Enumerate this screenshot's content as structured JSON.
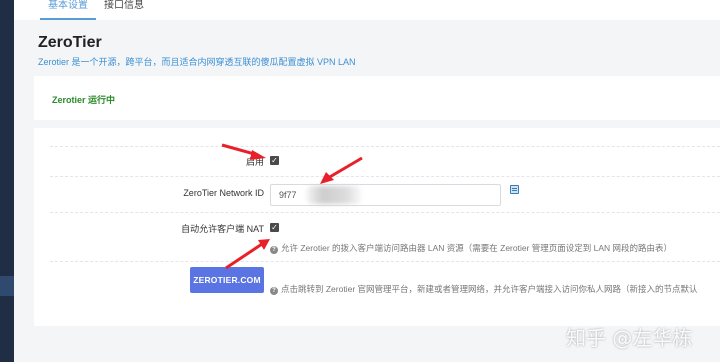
{
  "tabs": [
    {
      "label": "基本设置",
      "active": true
    },
    {
      "label": "接口信息",
      "active": false
    }
  ],
  "page": {
    "title": "ZeroTier",
    "description": "Zerotier 是一个开源，跨平台，而且适合内网穿透互联的傻瓜配置虚拟 VPN LAN"
  },
  "status": {
    "text": "Zerotier 运行中",
    "color": "#2b8a2b"
  },
  "form": {
    "enable_label": "启用",
    "enable_checked": true,
    "network_id_label": "ZeroTier Network ID",
    "network_id_value": "9f77",
    "nat_label": "自动允许客户端 NAT",
    "nat_checked": true,
    "nat_help": "允许 Zerotier 的拨入客户端访问路由器 LAN 资源（需要在 Zerotier 管理页面设定到 LAN 网段的路由表）",
    "button_label": "ZEROTIER.COM",
    "button_help": "点击跳转到 Zerotier 官网管理平台，新建或者管理网络，并允许客户端接入访问你私人网路（新接入的节点默认"
  },
  "colors": {
    "accent": "#5b9bd5",
    "button": "#5b74e3",
    "arrow": "#e8202a",
    "sidebar": "#1f2e44"
  },
  "watermark": "知乎 @左华栋"
}
